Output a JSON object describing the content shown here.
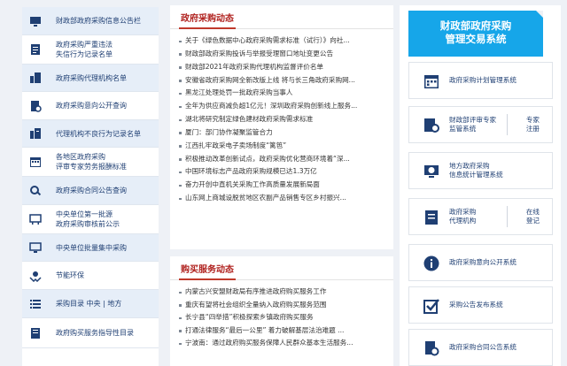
{
  "sidebar": {
    "items": [
      {
        "lines": [
          "财政部政府采购信息公告栏"
        ],
        "icon": "monitor-icon"
      },
      {
        "lines": [
          "政府采购严重违法",
          "失信行为记录名单"
        ],
        "icon": "document-list-icon"
      },
      {
        "lines": [
          "政府采购代理机构名单"
        ],
        "icon": "building-icon"
      },
      {
        "lines": [
          "政府采购意向公开查询"
        ],
        "icon": "clipboard-search-icon"
      },
      {
        "lines": [
          "代理机构不良行为记录名单"
        ],
        "icon": "building-warning-icon"
      },
      {
        "lines": [
          "各地区政府采购",
          "评审专家劳务报酬标准"
        ],
        "icon": "calendar-icon"
      },
      {
        "lines": [
          "政府采购合同公告查询"
        ],
        "icon": "search-icon"
      },
      {
        "lines": [
          "中央单位第一批源",
          "政府采购审核前公示"
        ],
        "icon": "notice-board-icon"
      },
      {
        "lines": [
          "中央单位批量集中采购"
        ],
        "icon": "computer-icon"
      },
      {
        "lines": [
          "节能环保"
        ],
        "icon": "hands-leaf-icon"
      },
      {
        "lines": [
          "采购目录  中央 | 地方"
        ],
        "icon": "list-icon"
      },
      {
        "lines": [
          "政府购买服务指导性目录"
        ],
        "icon": "book-icon"
      }
    ]
  },
  "news": {
    "title": "政府采购动态",
    "items": [
      "关于《绿色数据中心政府采购需求标准（试行）》向社...",
      "财政部政府采购投诉与举报受理窗口地址变更公告",
      "财政部2021年政府采购代理机构监督评价名单",
      "安徽省政府采购网全新改版上线 将与长三角政府采购网...",
      "黑龙江处理处罚一批政府采购当事人",
      "全年为供应商减负超1亿元！深圳政府采购创新线上服务...",
      "湖北将研究制定绿色建材政府采购需求标准",
      "厦门：部门协作凝聚监管合力",
      "江西扎牢政采电子卖场制度“篱笆”",
      "积极推动改革创新试点，政府采购优化营商环境着“深...",
      "中国环境标志产品政府采购规模已达1.3万亿",
      "奋力开创中直机关采购工作高质量发展新局面",
      "山东网上商城设脱贫地区农副产品销售专区乡村振兴..."
    ]
  },
  "services": {
    "title": "购买服务动态",
    "items": [
      "内蒙古兴安盟财政局有序推进政府购买服务工作",
      "重庆有望将社会组织全量纳入政府购买服务范围",
      "长宁县“四举措”积极探索乡镇政府购买服务",
      "打通法律服务“最后一公里” 着力破解基层法治难题 ...",
      "宁波南：通过政府购买服务保障人民群众基本生活服务..."
    ]
  },
  "right": {
    "banner": [
      "财政部政府采购",
      "管理交易系统"
    ],
    "systems": [
      {
        "lines": [
          "政府采购计划管理系统"
        ],
        "icon": "calendar-icon"
      },
      {
        "lines": [
          "财政部评审专家",
          "监管系统"
        ],
        "side": [
          "专家",
          "注册"
        ],
        "icon": "expert-icon"
      },
      {
        "lines": [
          "地方政府采购",
          "信息统计管理系统"
        ],
        "icon": "globe-monitor-icon"
      },
      {
        "lines": [
          "政府采购",
          "代理机构"
        ],
        "side": [
          "在线",
          "登记"
        ],
        "icon": "agency-icon"
      },
      {
        "lines": [
          "政府采购意向公开系统"
        ],
        "icon": "info-icon"
      },
      {
        "lines": [
          "采购公告发布系统"
        ],
        "icon": "checkbox-icon"
      },
      {
        "lines": [
          "政府采购合同公告系统"
        ],
        "icon": "contract-search-icon"
      }
    ]
  },
  "colors": {
    "accent": "#16a6e9",
    "title_red": "#b0221f",
    "link_blue": "#1f3f73"
  }
}
